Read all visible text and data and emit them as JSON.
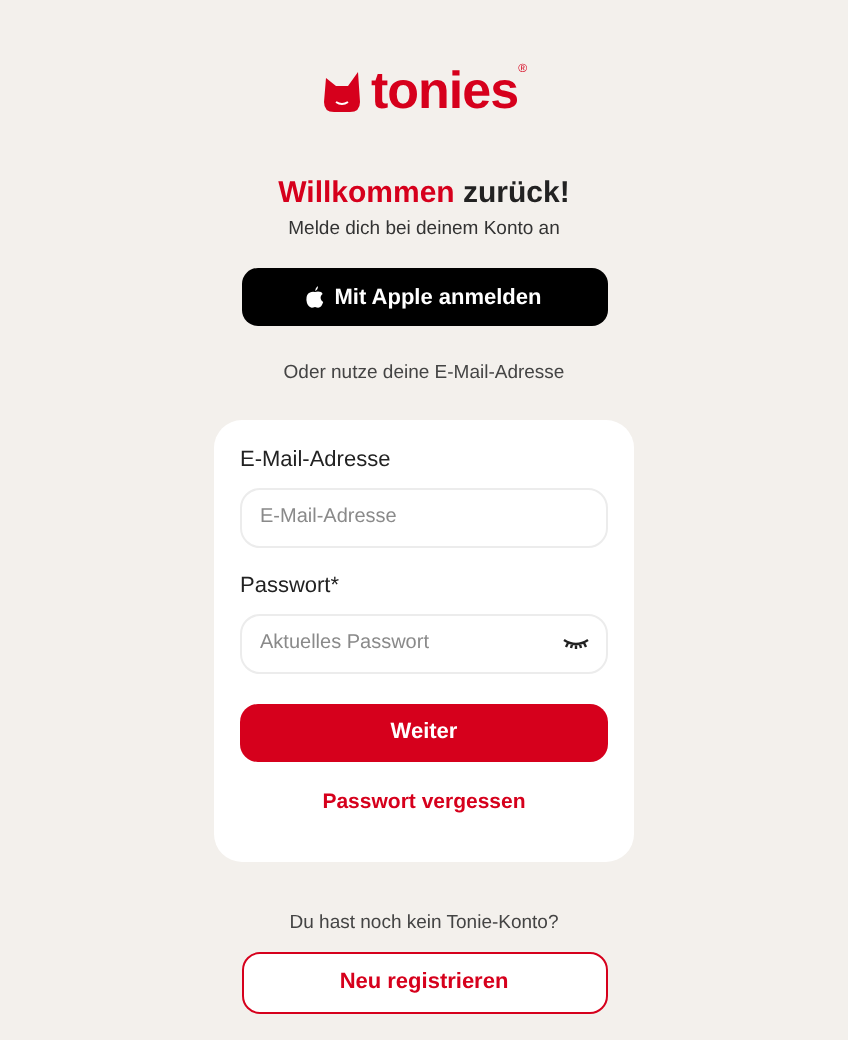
{
  "logo": {
    "wordmark": "tonies",
    "trademark": "®"
  },
  "heading": {
    "highlight": "Willkommen",
    "rest": "zurück!"
  },
  "subtitle": "Melde dich bei deinem Konto an",
  "apple_button": "Mit Apple anmelden",
  "divider_text": "Oder nutze deine E-Mail-Adresse",
  "form": {
    "fields": [
      {
        "label": "E-Mail-Adresse",
        "placeholder": "E-Mail-Adresse",
        "kind": "email"
      },
      {
        "label": "Passwort*",
        "placeholder": "Aktuelles Passwort",
        "kind": "password"
      }
    ],
    "submit": "Weiter",
    "forgot_link": "Passwort vergessen"
  },
  "register_prompt": "Du hast noch kein Tonie-Konto?",
  "register_button": "Neu registrieren"
}
